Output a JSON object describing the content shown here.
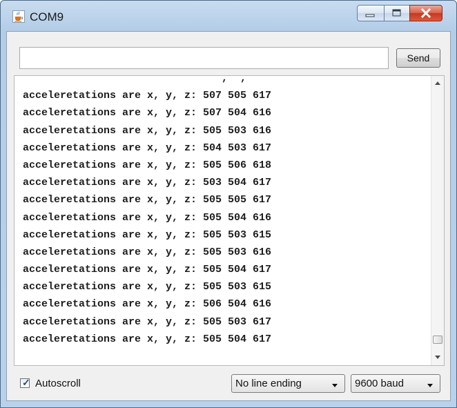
{
  "window": {
    "title": "COM9",
    "icon": "java-cup-icon"
  },
  "toolbar": {
    "input_value": "",
    "send_label": "Send"
  },
  "output": {
    "lines": [
      "                                ,  ,",
      "acceleretations are x, y, z: 507 505 617",
      "acceleretations are x, y, z: 507 504 616",
      "acceleretations are x, y, z: 505 503 616",
      "acceleretations are x, y, z: 504 503 617",
      "acceleretations are x, y, z: 505 506 618",
      "acceleretations are x, y, z: 503 504 617",
      "acceleretations are x, y, z: 505 505 617",
      "acceleretations are x, y, z: 505 504 616",
      "acceleretations are x, y, z: 505 503 615",
      "acceleretations are x, y, z: 505 503 616",
      "acceleretations are x, y, z: 505 504 617",
      "acceleretations are x, y, z: 505 503 615",
      "acceleretations are x, y, z: 506 504 616",
      "acceleretations are x, y, z: 505 503 617",
      "acceleretations are x, y, z: 505 504 617"
    ]
  },
  "footer": {
    "autoscroll_label": "Autoscroll",
    "line_ending": "No line ending",
    "baud": "9600 baud"
  },
  "colors": {
    "titlebar": "#b9d1ea",
    "close_button": "#c7371f",
    "panel": "#f0f0f0"
  }
}
